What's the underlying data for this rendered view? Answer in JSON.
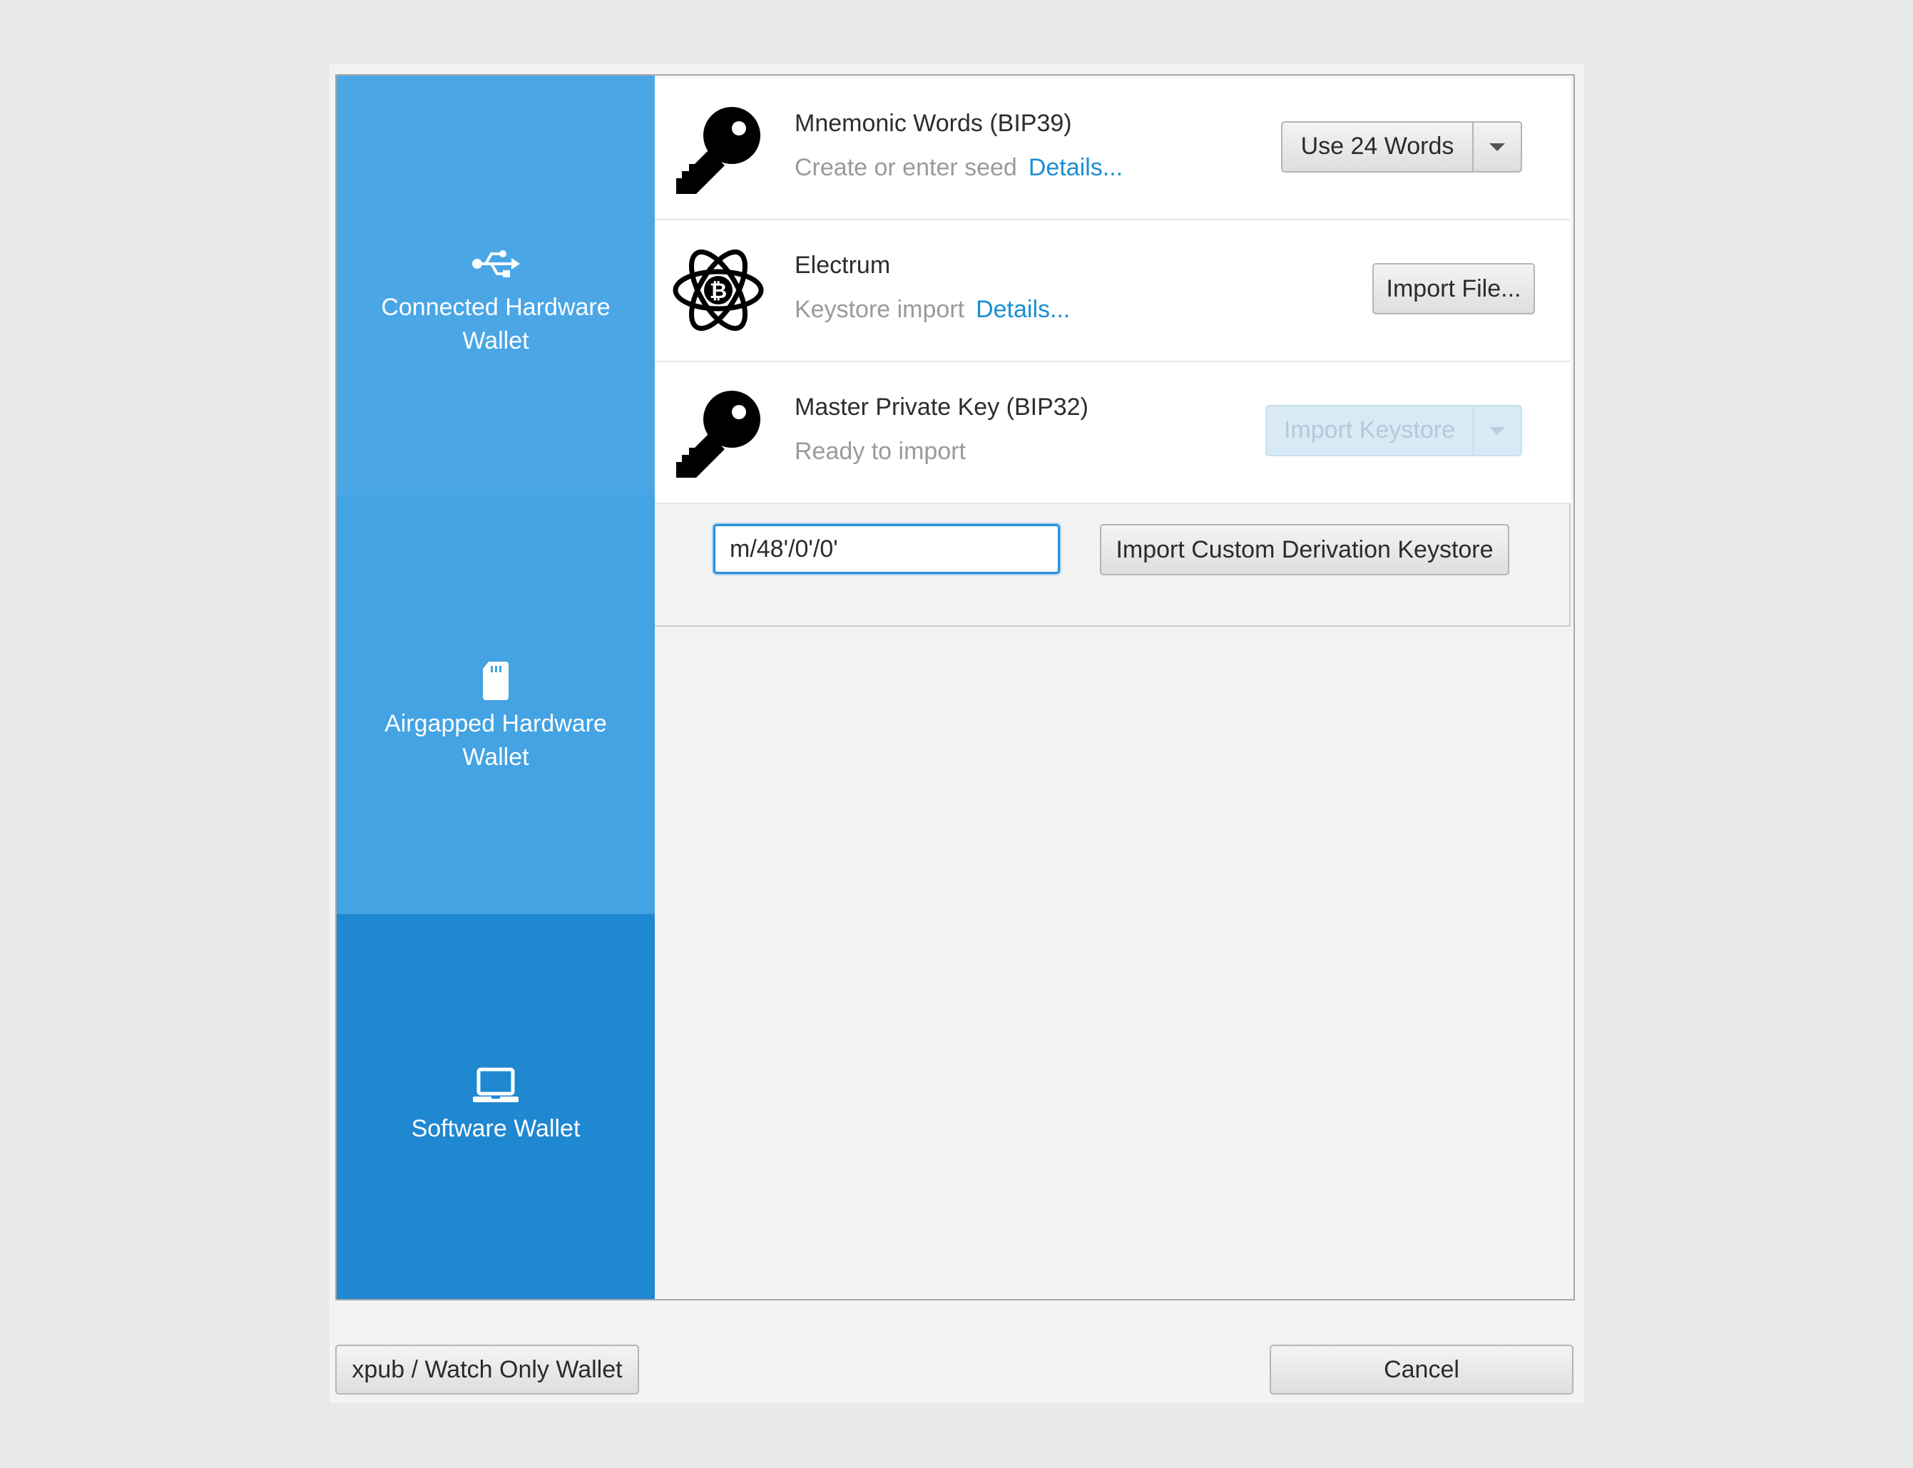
{
  "sidebar": {
    "items": [
      {
        "label_line1": "Connected Hardware",
        "label_line2": "Wallet",
        "icon": "usb-icon"
      },
      {
        "label_line1": "Airgapped Hardware",
        "label_line2": "Wallet",
        "icon": "sd-card-icon"
      },
      {
        "label_line1": "Software Wallet",
        "icon": "laptop-icon",
        "selected": true
      }
    ]
  },
  "cards": {
    "mnemonic": {
      "title": "Mnemonic Words (BIP39)",
      "subtitle": "Create or enter seed",
      "link": "Details...",
      "button": "Use 24 Words",
      "icon": "key-icon"
    },
    "electrum": {
      "title": "Electrum",
      "subtitle": "Keystore import",
      "link": "Details...",
      "button": "Import File...",
      "icon": "electrum-bitcoin-icon"
    },
    "master_key": {
      "title": "Master Private Key (BIP32)",
      "subtitle": "Ready to import",
      "button": "Import Keystore",
      "button_disabled": true,
      "icon": "key-icon"
    }
  },
  "derivation": {
    "value": "m/48'/0'/0'",
    "button": "Import Custom Derivation Keystore"
  },
  "footer": {
    "watch_only": "xpub / Watch Only Wallet",
    "cancel": "Cancel"
  },
  "colors": {
    "sidebar": "#4aa6e5",
    "sidebar_selected": "#2087d1",
    "link": "#1a8fd1",
    "focus": "#2a8fd8"
  }
}
